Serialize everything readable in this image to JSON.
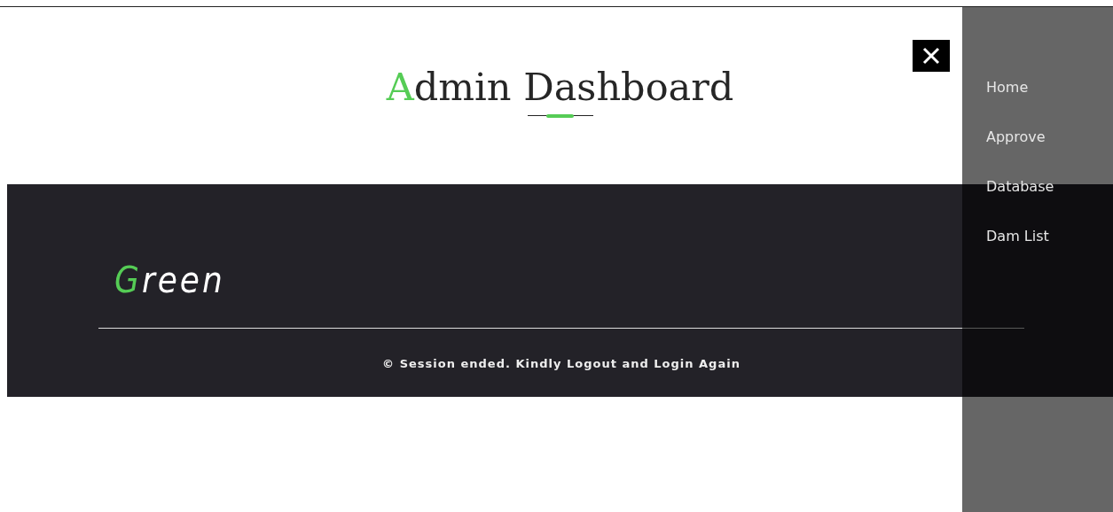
{
  "header": {
    "title": {
      "accent": "A",
      "rest": "dmin Dashboard"
    }
  },
  "footer": {
    "logo": {
      "accent": "G",
      "rest": "reen"
    },
    "notice": "© Session ended. Kindly Logout and Login Again"
  },
  "side_menu": {
    "open": true,
    "items": [
      {
        "label": "Home"
      },
      {
        "label": "Approve"
      },
      {
        "label": "Database"
      },
      {
        "label": "Dam List"
      }
    ]
  }
}
